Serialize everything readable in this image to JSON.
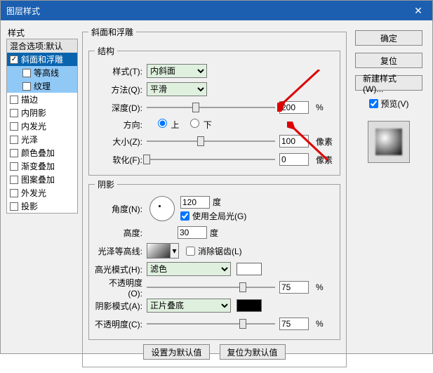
{
  "title": "图层样式",
  "left": {
    "header": "样式",
    "defaults": "混合选项:默认",
    "items": [
      {
        "label": "斜面和浮雕",
        "checked": true,
        "selected": true
      },
      {
        "label": "等高线",
        "checked": false,
        "sub": true,
        "selected": true
      },
      {
        "label": "纹理",
        "checked": false,
        "sub": true,
        "selected": true
      },
      {
        "label": "描边",
        "checked": false
      },
      {
        "label": "内阴影",
        "checked": false
      },
      {
        "label": "内发光",
        "checked": false
      },
      {
        "label": "光泽",
        "checked": false
      },
      {
        "label": "颜色叠加",
        "checked": false
      },
      {
        "label": "渐变叠加",
        "checked": false
      },
      {
        "label": "图案叠加",
        "checked": false
      },
      {
        "label": "外发光",
        "checked": false
      },
      {
        "label": "投影",
        "checked": false
      }
    ]
  },
  "bevel": {
    "group_title": "斜面和浮雕",
    "struct_title": "结构",
    "style_label": "样式(T):",
    "style_value": "内斜面",
    "technique_label": "方法(Q):",
    "technique_value": "平滑",
    "depth_label": "深度(D):",
    "depth_value": "200",
    "depth_unit": "%",
    "direction_label": "方向:",
    "dir_up": "上",
    "dir_down": "下",
    "size_label": "大小(Z):",
    "size_value": "100",
    "size_unit": "像素",
    "soften_label": "软化(F):",
    "soften_value": "0",
    "soften_unit": "像素"
  },
  "shading": {
    "title": "阴影",
    "angle_label": "角度(N):",
    "angle_value": "120",
    "angle_unit": "度",
    "global_label": "使用全局光(G)",
    "altitude_label": "高度:",
    "altitude_value": "30",
    "altitude_unit": "度",
    "gloss_label": "光泽等高线:",
    "antialias_label": "消除锯齿(L)",
    "hi_mode_label": "高光模式(H):",
    "hi_mode_value": "滤色",
    "hi_opacity_label": "不透明度(O):",
    "hi_opacity_value": "75",
    "hi_opacity_unit": "%",
    "sh_mode_label": "阴影模式(A):",
    "sh_mode_value": "正片叠底",
    "sh_opacity_label": "不透明度(C):",
    "sh_opacity_value": "75",
    "sh_opacity_unit": "%"
  },
  "buttons": {
    "default_set": "设置为默认值",
    "default_reset": "复位为默认值"
  },
  "right": {
    "ok": "确定",
    "cancel": "复位",
    "new_style": "新建样式(W)...",
    "preview_label": "预览(V)"
  }
}
